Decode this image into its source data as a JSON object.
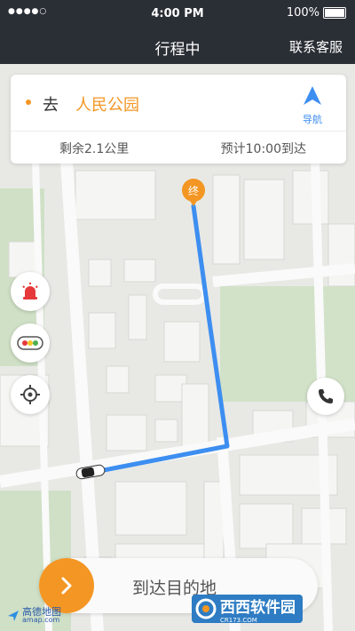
{
  "status_bar": {
    "signal": "●●●●○",
    "time": "4:00 PM",
    "battery": "100%"
  },
  "nav": {
    "title": "行程中",
    "service": "联系客服"
  },
  "trip": {
    "go_label": "去",
    "destination": "人民公园",
    "nav_label": "导航",
    "remaining": "剩余2.1公里",
    "eta": "预计10:00到达"
  },
  "map": {
    "end_marker": "终"
  },
  "slider": {
    "label": "到达目的地"
  },
  "logo": {
    "name": "高德地图",
    "sub": "amap.com"
  },
  "watermark": {
    "text": "西西软件园",
    "sub": "CR173.COM"
  },
  "icons": {
    "nav": "navigation-arrow-icon",
    "alarm": "alarm-light-icon",
    "traffic": "traffic-light-icon",
    "locate": "locate-icon",
    "phone": "phone-icon",
    "arrow": "chevron-right-icon",
    "car": "car-icon",
    "logo": "amap-logo-icon"
  },
  "colors": {
    "accent": "#f39623",
    "route": "#3d8ef0",
    "header": "#2a2e35",
    "alarm": "#e5393b"
  }
}
